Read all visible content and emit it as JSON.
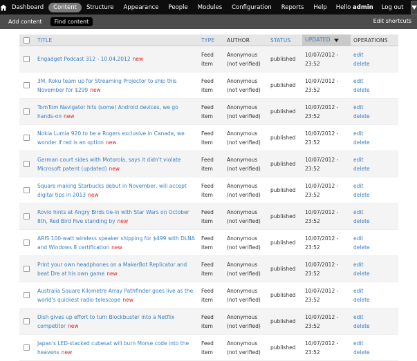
{
  "toolbar": {
    "menu": [
      "Dashboard",
      "Content",
      "Structure",
      "Appearance",
      "People",
      "Modules",
      "Configuration",
      "Reports",
      "Help"
    ],
    "active": "Content",
    "hello_prefix": "Hello ",
    "username": "admin",
    "logout": "Log out"
  },
  "shortcuts": {
    "items": [
      "Add content",
      "Find content"
    ],
    "active": "Find content",
    "edit_label": "Edit shortcuts"
  },
  "table": {
    "columns": {
      "title": "TITLE",
      "type": "TYPE",
      "author": "AUTHOR",
      "status": "STATUS",
      "updated": "UPDATED",
      "operations": "OPERATIONS"
    },
    "rows": [
      {
        "title": "Engadget Podcast 312 - 10.04.2012",
        "new": "new",
        "type1": "Feed",
        "type2": "item",
        "author1": "Anonymous",
        "author2": "(not verified)",
        "status": "published",
        "updated1": "10/07/2012 -",
        "updated2": "23:52",
        "edit": "edit",
        "delete": "delete"
      },
      {
        "title": "3M, Roku team up for Streaming Projector to ship this November for $299",
        "new": "new",
        "type1": "Feed",
        "type2": "item",
        "author1": "Anonymous",
        "author2": "(not verified)",
        "status": "published",
        "updated1": "10/07/2012 -",
        "updated2": "23:52",
        "edit": "edit",
        "delete": "delete"
      },
      {
        "title": "TomTom Navigator hits (some) Android devices, we go hands-on",
        "new": "new",
        "type1": "Feed",
        "type2": "item",
        "author1": "Anonymous",
        "author2": "(not verified)",
        "status": "published",
        "updated1": "10/07/2012 -",
        "updated2": "23:52",
        "edit": "edit",
        "delete": "delete"
      },
      {
        "title": "Nokia Lumia 920 to be a Rogers exclusive in Canada, we wonder if red is an option",
        "new": "new",
        "type1": "Feed",
        "type2": "item",
        "author1": "Anonymous",
        "author2": "(not verified)",
        "status": "published",
        "updated1": "10/07/2012 -",
        "updated2": "23:52",
        "edit": "edit",
        "delete": "delete"
      },
      {
        "title": "German court sides with Motorola, says it didn't violate Microsoft patent (updated)",
        "new": "new",
        "type1": "Feed",
        "type2": "item",
        "author1": "Anonymous",
        "author2": "(not verified)",
        "status": "published",
        "updated1": "10/07/2012 -",
        "updated2": "23:52",
        "edit": "edit",
        "delete": "delete"
      },
      {
        "title": "Square making Starbucks debut in November, will accept digital tips in 2013",
        "new": "new",
        "type1": "Feed",
        "type2": "item",
        "author1": "Anonymous",
        "author2": "(not verified)",
        "status": "published",
        "updated1": "10/07/2012 -",
        "updated2": "23:52",
        "edit": "edit",
        "delete": "delete"
      },
      {
        "title": "Rovio hints at Angry Birds tie-in with Star Wars on October 8th, Red Bird Five standing by",
        "new": "new",
        "type1": "Feed",
        "type2": "item",
        "author1": "Anonymous",
        "author2": "(not verified)",
        "status": "published",
        "updated1": "10/07/2012 -",
        "updated2": "23:52",
        "edit": "edit",
        "delete": "delete"
      },
      {
        "title": "ARIS 100-watt wireless speaker shipping for $499 with DLNA and Windows 8 certification",
        "new": "new",
        "type1": "Feed",
        "type2": "item",
        "author1": "Anonymous",
        "author2": "(not verified)",
        "status": "published",
        "updated1": "10/07/2012 -",
        "updated2": "23:52",
        "edit": "edit",
        "delete": "delete"
      },
      {
        "title": "Print your own headphones on a MakerBot Replicator and beat Dre at his own game",
        "new": "new",
        "type1": "Feed",
        "type2": "item",
        "author1": "Anonymous",
        "author2": "(not verified)",
        "status": "published",
        "updated1": "10/07/2012 -",
        "updated2": "23:52",
        "edit": "edit",
        "delete": "delete"
      },
      {
        "title": "Australia Square Kilometre Array Pathfinder goes live as the world's quickest radio telescope",
        "new": "new",
        "type1": "Feed",
        "type2": "item",
        "author1": "Anonymous",
        "author2": "(not verified)",
        "status": "published",
        "updated1": "10/07/2012 -",
        "updated2": "23:52",
        "edit": "edit",
        "delete": "delete"
      },
      {
        "title": "Dish gives up effort to turn Blockbuster into a Netflix competitor",
        "new": "new",
        "type1": "Feed",
        "type2": "item",
        "author1": "Anonymous",
        "author2": "(not verified)",
        "status": "published",
        "updated1": "10/07/2012 -",
        "updated2": "23:52",
        "edit": "edit",
        "delete": "delete"
      },
      {
        "title": "Japan's LED-stacked cubesat will burn Morse code into the heavens",
        "new": "new",
        "type1": "Feed",
        "type2": "item",
        "author1": "Anonymous",
        "author2": "(not verified)",
        "status": "published",
        "updated1": "10/07/2012 -",
        "updated2": "23:52",
        "edit": "edit",
        "delete": "delete"
      }
    ]
  },
  "colors": {
    "toolbar_bg": "#0d0d0d",
    "shortcuts_bg": "#4c4c4c",
    "link": "#3b7ec1",
    "new_badge": "#e02020",
    "header_bg": "#e6e6e6",
    "sorted_header_bg": "#c9c9c9"
  },
  "icons": {
    "home": "home-icon",
    "toggle": "chevron-down-icon",
    "sort": "sort-descending-icon"
  }
}
